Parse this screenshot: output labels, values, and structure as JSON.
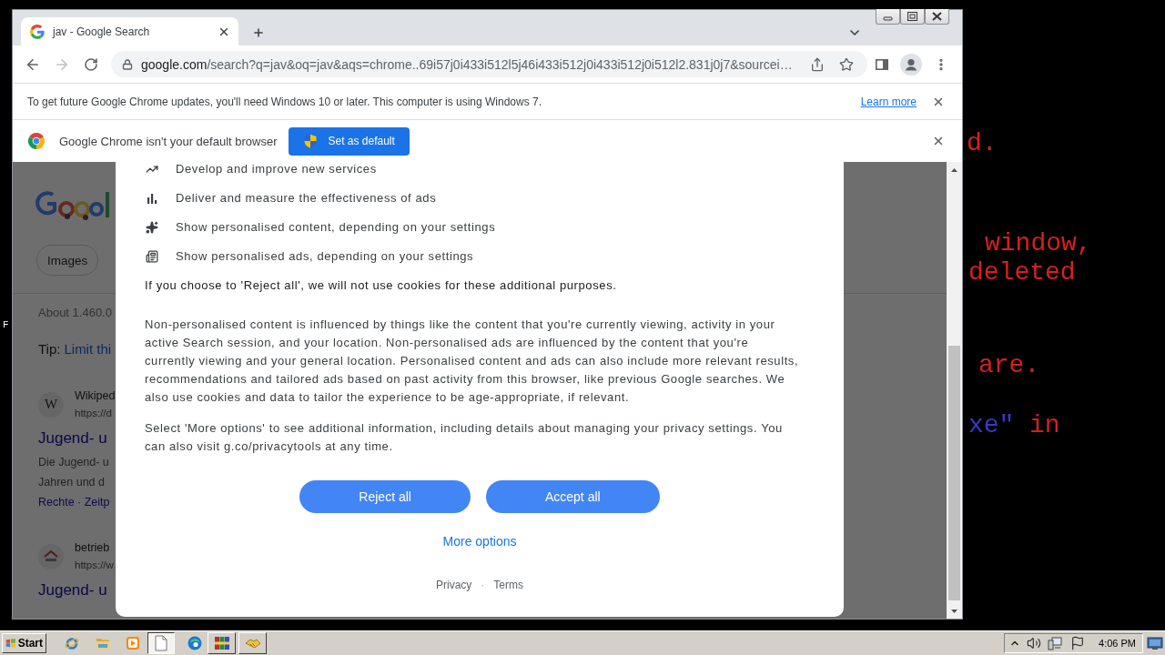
{
  "desktop": {
    "texts": [
      {
        "text": "F",
        "color": "#ffffff"
      },
      {
        "text": "d.",
        "color": "#d42020"
      },
      {
        "text": "window,",
        "color": "#d42020"
      },
      {
        "text": "deleted",
        "color": "#d42020"
      },
      {
        "text": "are.",
        "color": "#d42020"
      },
      {
        "text": "xe\"",
        "color": "#3838c8"
      },
      {
        "text": "in",
        "color": "#d42020"
      }
    ]
  },
  "browser": {
    "tabs": [
      {
        "title": "jav - Google Search",
        "selected": true
      }
    ],
    "address": {
      "host": "google.com",
      "path": "/search?q=jav&oq=jav&aqs=chrome..69i57j0i433i512l5j46i433i512j0i433i512j0i512l2.831j0j7&sourcei…"
    },
    "update_bar": {
      "text": "To get future Google Chrome updates, you'll need Windows 10 or later. This computer is using Windows 7.",
      "link": "Learn more"
    },
    "default_bar": {
      "text": "Google Chrome isn't your default browser",
      "button": "Set as default"
    },
    "results_page": {
      "chips": [
        "Images"
      ],
      "stats": "About 1.460.0",
      "tip_label": "Tip:",
      "tip_link": "Limit thi",
      "results": [
        {
          "favicon_letter": "W",
          "site": "Wikiped",
          "url": "https://d",
          "title": "Jugend- u",
          "snippet": [
            "Die Jugend- u",
            "Jahren und d"
          ],
          "sitelinks": "Rechte · Zeitp"
        },
        {
          "site": "betrieb",
          "url": "https://w",
          "title": "Jugend- u"
        }
      ]
    },
    "consent": {
      "purposes": [
        "Develop and improve new services",
        "Deliver and measure the effectiveness of ads",
        "Show personalised content, depending on your settings",
        "Show personalised ads, depending on your settings"
      ],
      "reject_notice": "If you choose to 'Reject all', we will not use cookies for these additional purposes.",
      "paragraphs": [
        "Non-personalised content is influenced by things like the content that you're currently viewing, activity in your active Search session, and your location. Non-personalised ads are influenced by the content that you're currently viewing and your general location. Personalised content and ads can also include more relevant results, recommendations and tailored ads based on past activity from this browser, like previous Google searches. We also use cookies and data to tailor the experience to be age-appropriate, if relevant.",
        "Select 'More options' to see additional information, including details about managing your privacy settings. You can also visit g.co/privacytools at any time."
      ],
      "buttons": [
        "Reject all",
        "Accept all"
      ],
      "more_options": "More options",
      "footer": {
        "links": [
          "Privacy",
          "Terms"
        ],
        "separator": "·"
      }
    }
  },
  "taskbar": {
    "start": "Start",
    "items": [
      {
        "kind": "launch",
        "selected": false
      },
      {
        "kind": "launch",
        "selected": false
      },
      {
        "kind": "launch",
        "selected": false
      },
      {
        "kind": "task",
        "selected": true
      },
      {
        "kind": "launch",
        "selected": false
      },
      {
        "kind": "task",
        "selected": false
      },
      {
        "kind": "task",
        "selected": false
      }
    ],
    "clock": "4:06 PM"
  }
}
